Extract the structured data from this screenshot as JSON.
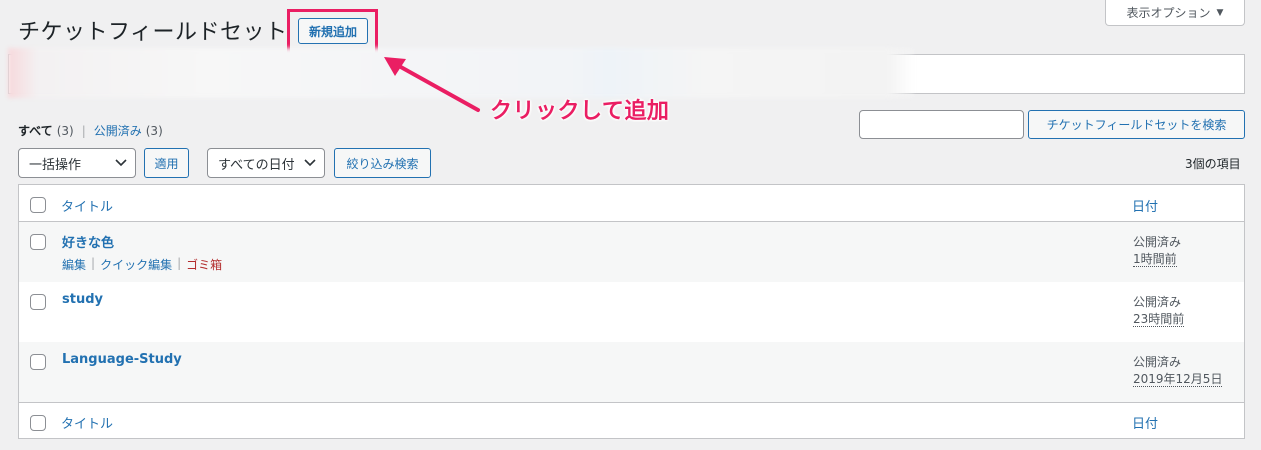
{
  "header": {
    "page_title": "チケットフィールドセット",
    "add_new_label": "新規追加",
    "screen_options_label": "表示オプション",
    "screen_options_arrow": "▼"
  },
  "annotation": {
    "text": "クリックして追加",
    "color": "#ea1e63"
  },
  "views": {
    "all_label": "すべて",
    "all_count": "(3)",
    "separator": "|",
    "published_label": "公開済み",
    "published_count": "(3)"
  },
  "search": {
    "input_value": "",
    "button_label": "チケットフィールドセットを検索"
  },
  "toolbar": {
    "bulk_action_selected": "一括操作",
    "apply_label": "適用",
    "date_filter_selected": "すべての日付",
    "filter_label": "絞り込み検索",
    "items_count": "3個の項目"
  },
  "table": {
    "columns": {
      "title": "タイトル",
      "date": "日付"
    },
    "rows": [
      {
        "title": "好きな色",
        "status": "公開済み",
        "date": "1時間前",
        "actions": {
          "edit": "編集",
          "quick_edit": "クイック編集",
          "trash": "ゴミ箱",
          "separator": "|"
        }
      },
      {
        "title": "study",
        "status": "公開済み",
        "date": "23時間前"
      },
      {
        "title": "Language-Study",
        "status": "公開済み",
        "date": "2019年12月5日"
      }
    ]
  },
  "icons": {
    "chevron": "chevron-down-icon"
  },
  "colors": {
    "accent": "#2271b1",
    "trash": "#b32d2e",
    "highlight": "#ea1e63"
  }
}
